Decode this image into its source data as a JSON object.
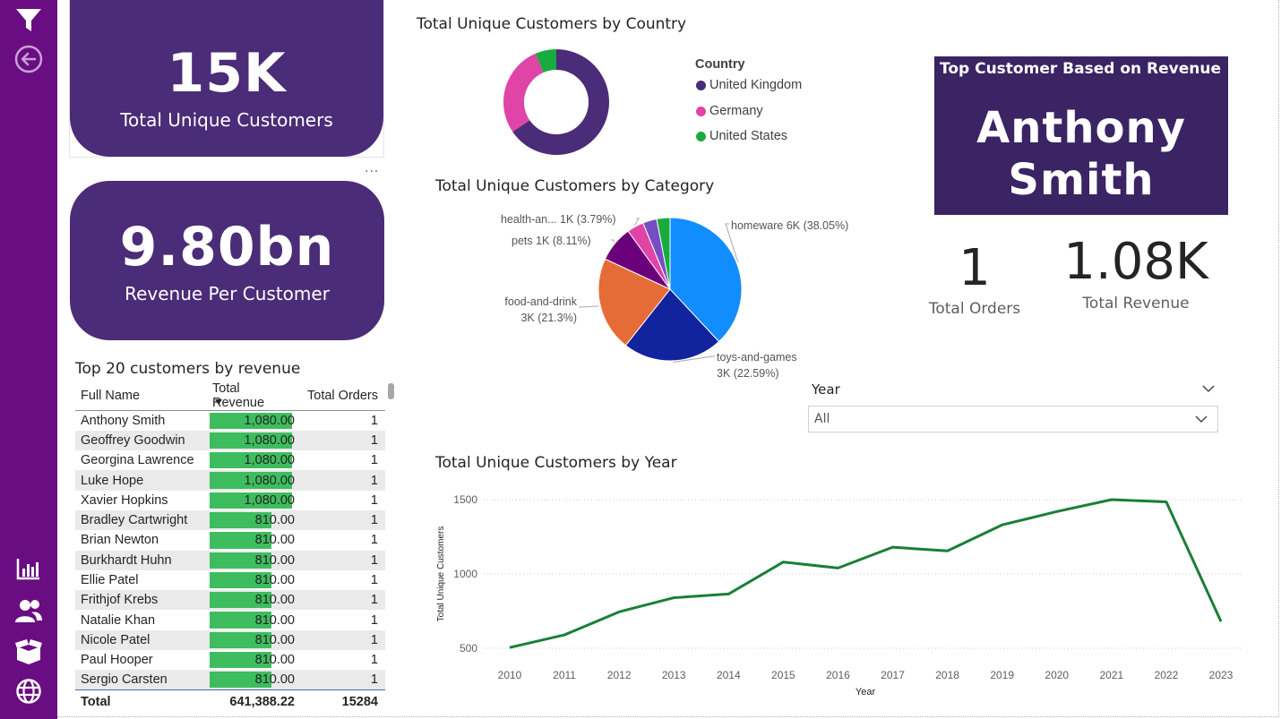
{
  "cards": {
    "unique_customers": {
      "value": "15K",
      "label": "Total Unique Customers"
    },
    "revenue_per_customer": {
      "value": "9.80bn",
      "label": "Revenue Per Customer"
    }
  },
  "more_options": "...",
  "titles": {
    "country": "Total Unique Customers by Country",
    "category": "Total Unique Customers by Category",
    "year": "Total Unique Customers by Year",
    "table": "Top 20 customers by revenue"
  },
  "country_legend": {
    "title": "Country",
    "items": [
      {
        "label": "United Kingdom",
        "color": "#4b2c78"
      },
      {
        "label": "Germany",
        "color": "#e044a7"
      },
      {
        "label": "United States",
        "color": "#1aab40"
      }
    ]
  },
  "category_labels": {
    "health": "health-an... 1K (3.79%)",
    "pets": "pets 1K (8.11%)",
    "food_line1": "food-and-drink",
    "food_line2": "3K (21.3%)",
    "homeware": "homeware 6K (38.05%)",
    "toys_line1": "toys-and-games",
    "toys_line2": "3K (22.59%)"
  },
  "top_customer": {
    "title": "Top Customer Based on Revenue",
    "name_line1": "Anthony",
    "name_line2": "Smith"
  },
  "kpis": {
    "orders": {
      "value": "1",
      "label": "Total Orders"
    },
    "revenue": {
      "value": "1.08K",
      "label": "Total Revenue"
    }
  },
  "slicer": {
    "title": "Year",
    "value": "All"
  },
  "table": {
    "headers": [
      "Full Name",
      "Total Revenue",
      "Total Orders"
    ],
    "rows": [
      {
        "name": "Anthony Smith",
        "revenue": "1,080.00",
        "orders": "1"
      },
      {
        "name": "Geoffrey Goodwin",
        "revenue": "1,080.00",
        "orders": "1"
      },
      {
        "name": "Georgina Lawrence",
        "revenue": "1,080.00",
        "orders": "1"
      },
      {
        "name": "Luke Hope",
        "revenue": "1,080.00",
        "orders": "1"
      },
      {
        "name": "Xavier Hopkins",
        "revenue": "1,080.00",
        "orders": "1"
      },
      {
        "name": "Bradley Cartwright",
        "revenue": "810.00",
        "orders": "1"
      },
      {
        "name": "Brian Newton",
        "revenue": "810.00",
        "orders": "1"
      },
      {
        "name": "Burkhardt Huhn",
        "revenue": "810.00",
        "orders": "1"
      },
      {
        "name": "Ellie Patel",
        "revenue": "810.00",
        "orders": "1"
      },
      {
        "name": "Frithjof Krebs",
        "revenue": "810.00",
        "orders": "1"
      },
      {
        "name": "Natalie Khan",
        "revenue": "810.00",
        "orders": "1"
      },
      {
        "name": "Nicole Patel",
        "revenue": "810.00",
        "orders": "1"
      },
      {
        "name": "Paul Hooper",
        "revenue": "810.00",
        "orders": "1"
      },
      {
        "name": "Sergio Carsten",
        "revenue": "810.00",
        "orders": "1"
      }
    ],
    "total": {
      "label": "Total",
      "revenue": "641,388.22",
      "orders": "15284"
    }
  },
  "sidebar_icons": [
    "filter-icon",
    "back-icon",
    "bar-chart-icon",
    "users-icon",
    "box-icon",
    "globe-icon"
  ],
  "chart_data": [
    {
      "type": "pie",
      "subtype": "donut",
      "title": "Total Unique Customers by Country",
      "legend_title": "Country",
      "legend_position": "right",
      "categories": [
        "United Kingdom",
        "Germany",
        "United States"
      ],
      "values": [
        0.655,
        0.28,
        0.065
      ],
      "colors": [
        "#4b2c78",
        "#e044a7",
        "#1aab40"
      ]
    },
    {
      "type": "pie",
      "title": "Total Unique Customers by Category",
      "categories": [
        "homeware",
        "toys-and-games",
        "food-and-drink",
        "pets",
        "health-an...",
        "other1",
        "other2"
      ],
      "values": [
        38.05,
        22.59,
        21.3,
        8.11,
        3.79,
        3.16,
        3.0
      ],
      "colors": [
        "#118dff",
        "#12239e",
        "#e66c37",
        "#6b007b",
        "#e044a7",
        "#744ec2",
        "#1aab40"
      ]
    },
    {
      "type": "line",
      "title": "Total Unique Customers by Year",
      "xlabel": "Year",
      "ylabel": "Total Unique Customers",
      "x": [
        2010,
        2011,
        2012,
        2013,
        2014,
        2015,
        2016,
        2017,
        2018,
        2019,
        2020,
        2021,
        2022,
        2023
      ],
      "series": [
        {
          "values": [
            505,
            590,
            745,
            840,
            865,
            1080,
            1040,
            1180,
            1155,
            1330,
            1420,
            1500,
            1485,
            680
          ],
          "color": "#1a7f37"
        }
      ],
      "ylim": [
        500,
        1500
      ],
      "yticks": [
        500,
        1000,
        1500
      ],
      "grid": true
    }
  ]
}
